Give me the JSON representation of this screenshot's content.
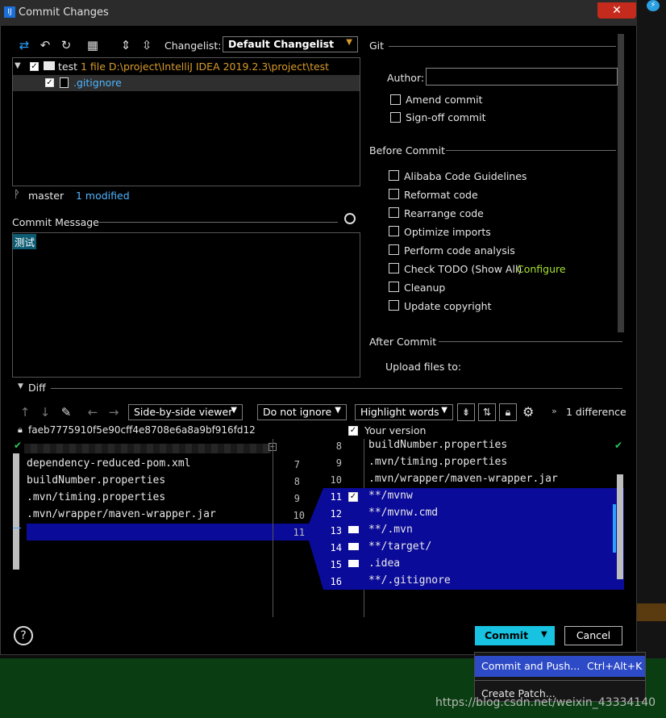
{
  "window": {
    "title": "Commit Changes",
    "close": "✕"
  },
  "toolbar": {
    "changelist_label": "Changelist:",
    "changelist_value": "Default Changelist"
  },
  "tree": {
    "root": {
      "name": "test",
      "info": "1 file  D:\\project\\IntelliJ IDEA 2019.2.3\\project\\test"
    },
    "child": {
      "name": ".gitignore"
    }
  },
  "status": {
    "branch": "master",
    "modified": "1 modified"
  },
  "commit_message": {
    "label": "Commit Message",
    "text": "测试"
  },
  "git": {
    "section": "Git",
    "author_label": "Author:",
    "author_value": "",
    "amend": "Amend commit",
    "signoff": "Sign-off commit"
  },
  "before_commit": {
    "section": "Before Commit",
    "items": [
      "Alibaba Code Guidelines",
      "Reformat code",
      "Rearrange code",
      "Optimize imports",
      "Perform code analysis",
      "Check TODO (Show All)",
      "Cleanup",
      "Update copyright"
    ],
    "configure_link": "Configure"
  },
  "after_commit": {
    "section": "After Commit",
    "upload_label": "Upload files to:"
  },
  "diff": {
    "label": "Diff",
    "viewer": "Side-by-side viewer",
    "ignore": "Do not ignore",
    "highlight": "Highlight words",
    "differences": "1 difference",
    "left_revision": "faeb7775910f5e90cff4e8708e6a8a9bf916fd12",
    "right_title": "Your version",
    "left_lines": [
      {
        "num": "7",
        "text": "dependency-reduced-pom.xml"
      },
      {
        "num": "8",
        "text": "buildNumber.properties"
      },
      {
        "num": "9",
        "text": ".mvn/timing.properties"
      },
      {
        "num": "10",
        "text": ".mvn/wrapper/maven-wrapper.jar"
      },
      {
        "num": "11",
        "text": ""
      }
    ],
    "right_lines": [
      {
        "num": "8",
        "text": "buildNumber.properties"
      },
      {
        "num": "9",
        "text": ".mvn/timing.properties"
      },
      {
        "num": "10",
        "text": ".mvn/wrapper/maven-wrapper.jar"
      },
      {
        "num": "11",
        "text": "**/mvnw"
      },
      {
        "num": "12",
        "text": "**/mvnw.cmd"
      },
      {
        "num": "13",
        "text": "**/.mvn"
      },
      {
        "num": "14",
        "text": "**/target/"
      },
      {
        "num": "15",
        "text": ".idea"
      },
      {
        "num": "16",
        "text": "**/.gitignore"
      }
    ]
  },
  "buttons": {
    "help": "?",
    "commit": "Commit",
    "cancel": "Cancel"
  },
  "menu": {
    "item1": "Commit and Push...",
    "item1_shortcut": "Ctrl+Alt+K",
    "item2": "Create Patch..."
  },
  "watermark": "https://blog.csdn.net/weixin_43334140"
}
